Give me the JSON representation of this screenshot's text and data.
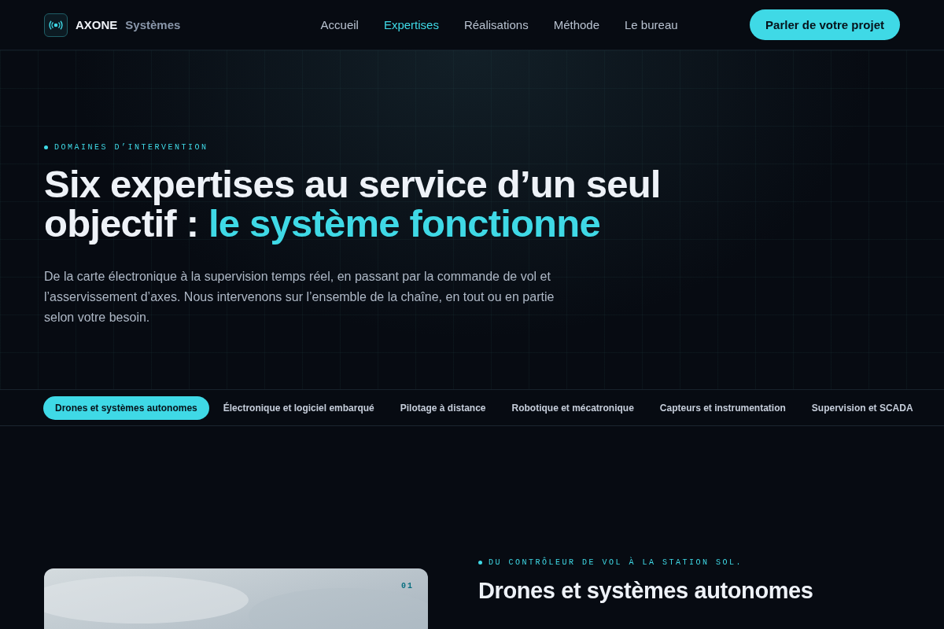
{
  "brand": {
    "name": "AXONE",
    "suffix": "Systèmes"
  },
  "nav": [
    {
      "label": "Accueil",
      "selected": false
    },
    {
      "label": "Expertises",
      "selected": true
    },
    {
      "label": "Réalisations",
      "selected": false
    },
    {
      "label": "Méthode",
      "selected": false
    },
    {
      "label": "Le bureau",
      "selected": false
    }
  ],
  "cta": "Parler de votre projet",
  "hero": {
    "eyebrow": "DOMAINES D’INTERVENTION",
    "title": "Six expertises au service d’un seul objectif : ",
    "title_accent": "le système fonctionne",
    "lead": "De la carte électronique à la supervision temps réel, en passant par la commande de vol et l’asservissement d’axes. Nous intervenons sur l’ensemble de la chaîne, en tout ou en partie selon votre besoin."
  },
  "tabs": [
    {
      "label": "Drones et systèmes autonomes",
      "selected": true
    },
    {
      "label": "Électronique et logiciel embarqué",
      "selected": false
    },
    {
      "label": "Pilotage à distance",
      "selected": false
    },
    {
      "label": "Robotique et mécatronique",
      "selected": false
    },
    {
      "label": "Capteurs et instrumentation",
      "selected": false
    },
    {
      "label": "Supervision et SCADA",
      "selected": false
    }
  ],
  "section": {
    "image": {
      "kind": "picture",
      "index": "01"
    },
    "eyebrow": "DU CONTRÔLEUR DE VOL À LA STATION SOL.",
    "title": "Drones et systèmes autonomes"
  }
}
